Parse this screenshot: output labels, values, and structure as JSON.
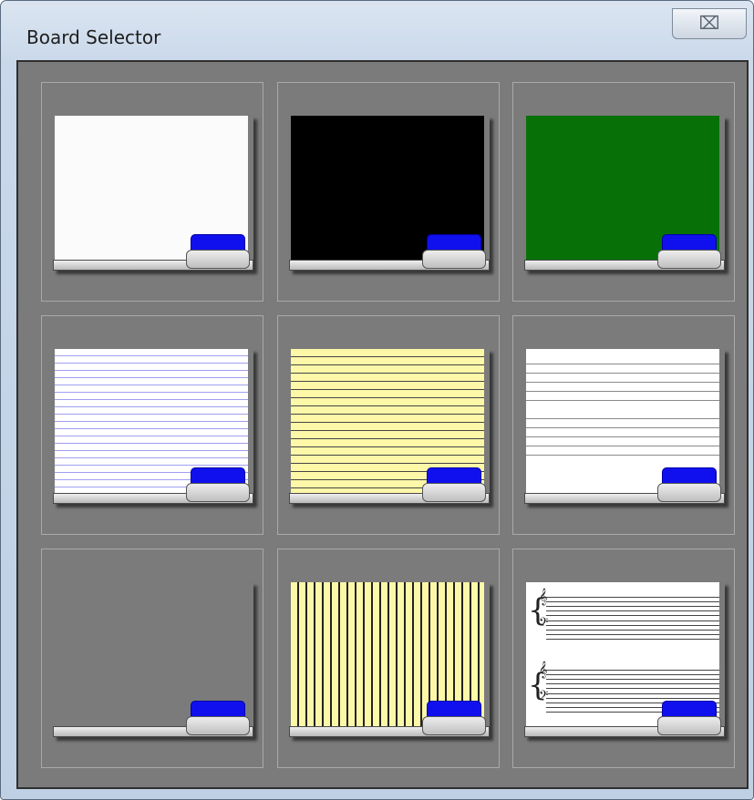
{
  "window": {
    "title": "Board Selector",
    "close_glyph": "⌧"
  },
  "boards": [
    {
      "name": "plain-white",
      "background": "#fbfbfb"
    },
    {
      "name": "plain-black",
      "background": "#000000"
    },
    {
      "name": "plain-green",
      "background": "#077107"
    },
    {
      "name": "lined-white-blue",
      "background": "#ffffff",
      "line_color": "#9f9ff0"
    },
    {
      "name": "lined-yellow",
      "background": "#fdf8a8",
      "line_color": "#444444"
    },
    {
      "name": "staff-white",
      "background": "#ffffff",
      "line_color": "#8a8a8a"
    },
    {
      "name": "grid-blue",
      "background": "#ffffff",
      "line_color": "#1a1acc"
    },
    {
      "name": "grid-yellow",
      "background": "#fdf8a8",
      "line_color": "#222222"
    },
    {
      "name": "music-staff",
      "background": "#ffffff",
      "line_color": "#444444"
    }
  ],
  "colors": {
    "eraser": "#1010ee",
    "panel": "#7b7b7b"
  }
}
